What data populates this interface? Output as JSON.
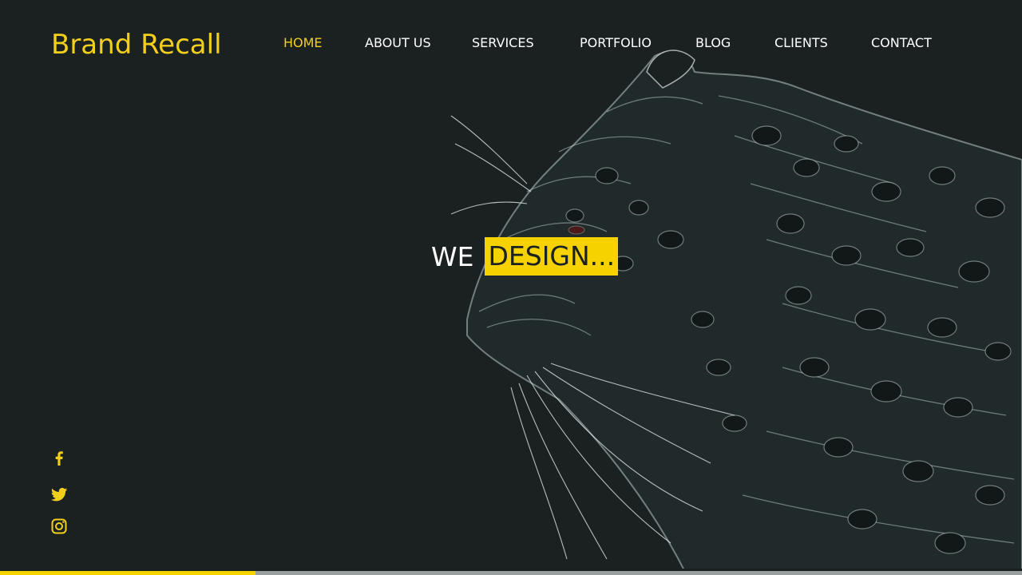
{
  "brand": {
    "name": "Brand Recall"
  },
  "nav": {
    "items": [
      {
        "label": "HOME",
        "active": true
      },
      {
        "label": "ABOUT US",
        "active": false
      },
      {
        "label": "SERVICES",
        "active": false
      },
      {
        "label": "PORTFOLIO",
        "active": false
      },
      {
        "label": "BLOG",
        "active": false
      },
      {
        "label": "CLIENTS",
        "active": false
      },
      {
        "label": "CONTACT",
        "active": false
      }
    ]
  },
  "hero": {
    "word": "WE",
    "highlight": "DESIGN..."
  },
  "social": {
    "icons": [
      "facebook-icon",
      "twitter-icon",
      "instagram-icon"
    ]
  },
  "colors": {
    "accent": "#f2cf1d",
    "background": "#1b2121",
    "text": "#ffffff"
  },
  "slider": {
    "progress": 0.25
  }
}
